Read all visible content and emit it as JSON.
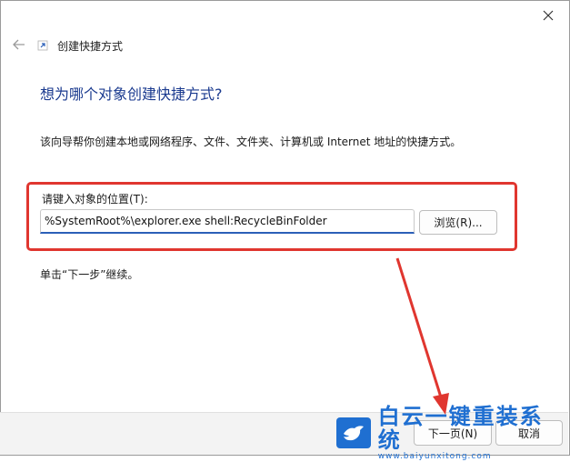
{
  "window": {
    "title": "创建快捷方式"
  },
  "content": {
    "heading": "想为哪个对象创建快捷方式?",
    "description": "该向导帮你创建本地或网络程序、文件、文件夹、计算机或 Internet 地址的快捷方式。",
    "location_label": "请键入对象的位置(T):",
    "location_value": "%SystemRoot%\\explorer.exe shell:RecycleBinFolder",
    "browse_label": "浏览(R)...",
    "continue_text": "单击“下一步”继续。"
  },
  "footer": {
    "next_label": "下一页(N)",
    "cancel_label": "取消"
  },
  "annotations": {
    "highlight_color": "#e0362f",
    "arrow_color": "#e0362f"
  },
  "watermark": {
    "cn": "白云一键重装系统",
    "en": "www.baiyunxitong.com",
    "logo_icon": "bird-logo-icon",
    "color": "#1f6fd1"
  },
  "colors": {
    "heading": "#1a3a8f",
    "input_focus": "#2b5fb8",
    "footer_bg": "#f3f3f3"
  }
}
